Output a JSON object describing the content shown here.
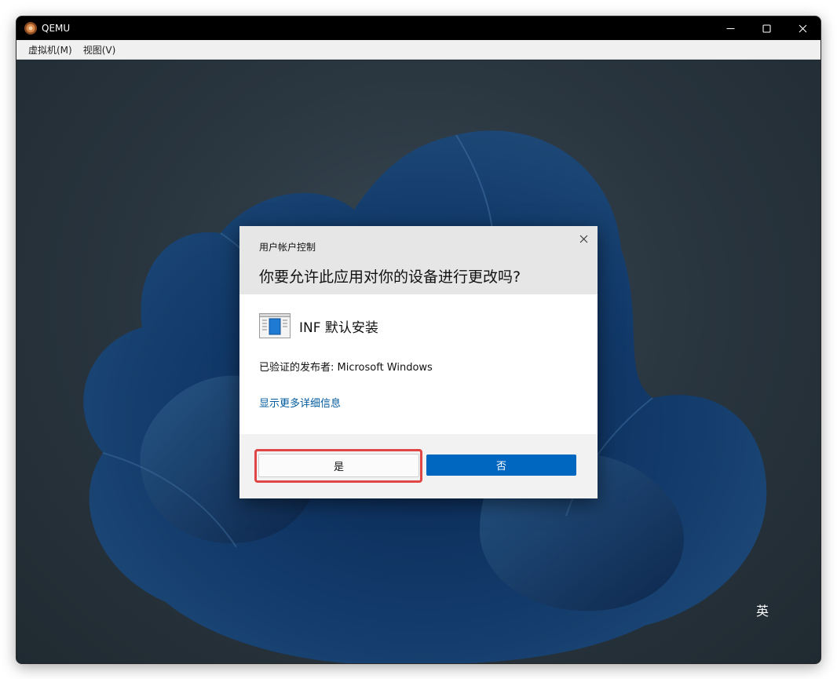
{
  "window": {
    "title": "QEMU",
    "app_icon": "qemu-icon",
    "controls": {
      "minimize": "minimize-icon",
      "maximize": "maximize-icon",
      "close": "close-icon"
    }
  },
  "menubar": {
    "items": [
      {
        "label": "虚拟机(M)"
      },
      {
        "label": "视图(V)"
      }
    ]
  },
  "desktop": {
    "ime_indicator": "英"
  },
  "uac_dialog": {
    "header_title": "用户帐户控制",
    "question": "你要允许此应用对你的设备进行更改吗?",
    "app_name": "INF 默认安装",
    "publisher": "已验证的发布者: Microsoft Windows",
    "details_link": "显示更多详细信息",
    "yes_label": "是",
    "no_label": "否",
    "colors": {
      "primary_button": "#0067c0",
      "highlight_frame": "#e04646",
      "link": "#005a9e"
    }
  }
}
